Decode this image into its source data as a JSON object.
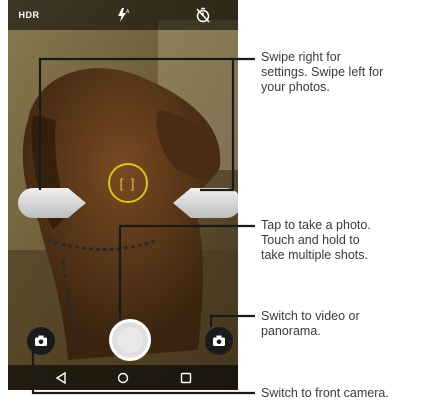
{
  "top_bar": {
    "hdr_label": "HDR",
    "icons": [
      "hdr-icon",
      "flash-auto-icon",
      "timer-off-icon"
    ]
  },
  "viewfinder": {
    "focus_bracket": "[ ]"
  },
  "nav_bar": {
    "icons": [
      "back-icon",
      "home-icon",
      "recents-icon"
    ]
  },
  "callouts": {
    "swipe": "Swipe right for\nsettings. Swipe left for\nyour photos.",
    "shutter": "Tap to take a photo.\nTouch and hold to\ntake multiple shots.",
    "video": "Switch to video or\npanorama.",
    "front_camera": "Switch to front camera."
  },
  "colors": {
    "focus_ring": "#d9c21a",
    "leader_line": "#1a1a1a",
    "callout_text": "#3a3a3a"
  }
}
